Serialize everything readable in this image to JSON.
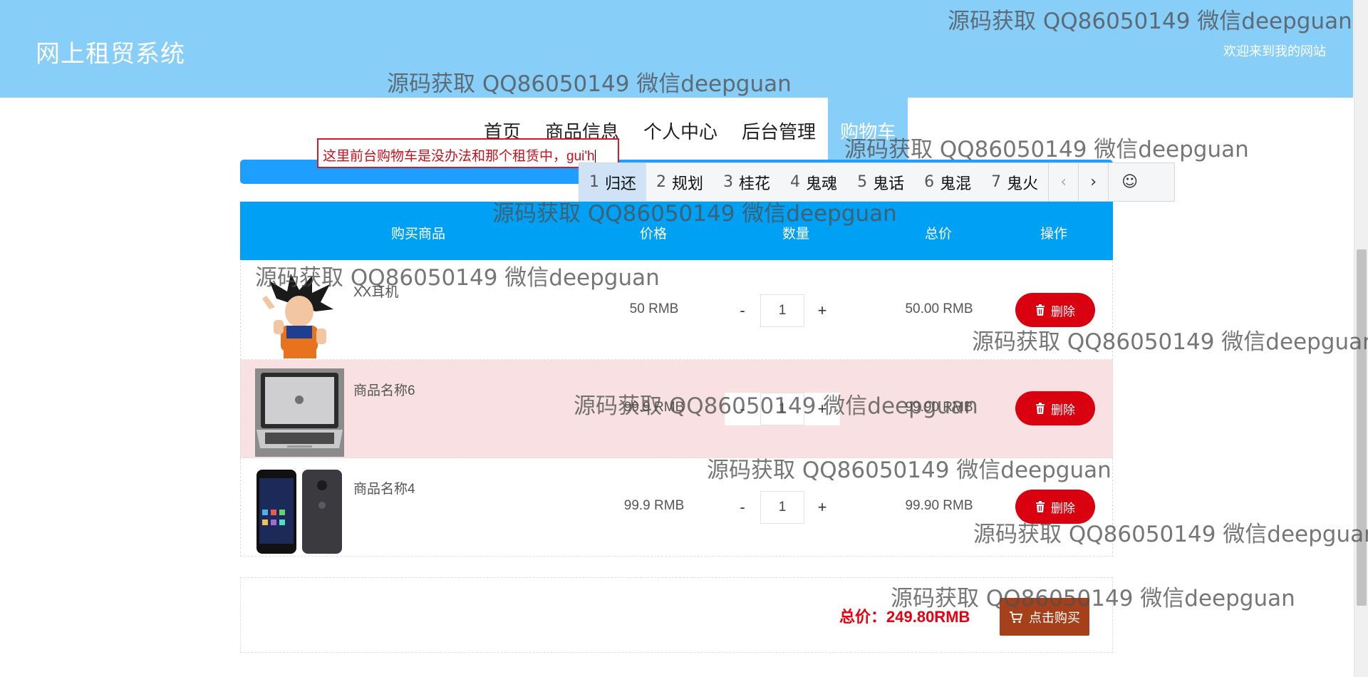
{
  "header": {
    "site_title": "网上租贸系统",
    "welcome": "欢迎来到我的网站"
  },
  "nav": {
    "items": [
      {
        "label": "首页"
      },
      {
        "label": "商品信息"
      },
      {
        "label": "个人中心"
      },
      {
        "label": "后台管理"
      },
      {
        "label": "购物车",
        "active": true
      }
    ]
  },
  "annotation": {
    "text": "这里前台购物车是没办法和那个租赁中，gui'h"
  },
  "ime": {
    "candidates": [
      {
        "num": "1",
        "text": "归还"
      },
      {
        "num": "2",
        "text": "规划"
      },
      {
        "num": "3",
        "text": "桂花"
      },
      {
        "num": "4",
        "text": "鬼魂"
      },
      {
        "num": "5",
        "text": "鬼话"
      },
      {
        "num": "6",
        "text": "鬼混"
      },
      {
        "num": "7",
        "text": "鬼火"
      }
    ],
    "prev": "‹",
    "next": "›",
    "emoji": "☺"
  },
  "table": {
    "headers": [
      "购买商品",
      "价格",
      "数量",
      "总价",
      "操作"
    ],
    "rows": [
      {
        "name": "XX耳机",
        "price": "50 RMB",
        "qty": "1",
        "subtotal": "50.00 RMB",
        "image": "goku-figure",
        "highlight": false
      },
      {
        "name": "商品名称6",
        "price": "99.9 RMB",
        "qty": "1",
        "subtotal": "99.90 RMB",
        "image": "laptop",
        "highlight": true
      },
      {
        "name": "商品名称4",
        "price": "99.9 RMB",
        "qty": "1",
        "subtotal": "99.90 RMB",
        "image": "phone",
        "highlight": false
      }
    ],
    "minus": "-",
    "plus": "+",
    "delete_label": "删除"
  },
  "footer": {
    "total_label": "总价：",
    "total_value": "249.80RMB",
    "buy_label": "点击购买"
  },
  "watermark": "源码获取 QQ86050149 微信deepguan",
  "colors": {
    "header_bg": "#87cef9",
    "table_head_bg": "#00a0f5",
    "delete_btn": "#d9000f",
    "buy_btn": "#a6401a",
    "total_text": "#e60012",
    "annotation": "#cf1d2b"
  }
}
